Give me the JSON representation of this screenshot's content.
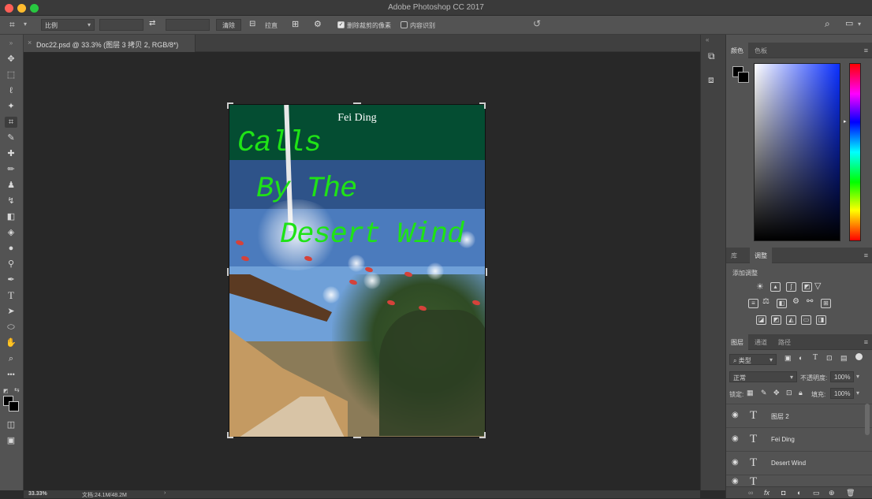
{
  "window": {
    "title": "Adobe Photoshop CC 2017",
    "traffic_lights": {
      "close": "#fe5f57",
      "minimize": "#febc2e",
      "zoom": "#28c840"
    }
  },
  "options_bar": {
    "tool_icon": "crop-icon",
    "ratio_select": "比例",
    "clear_button": "清除",
    "straighten_label": "拉直",
    "delete_cropped_label": "删除裁剪的像素",
    "delete_cropped_checked": true,
    "content_aware_label": "内容识别",
    "content_aware_checked": false
  },
  "document_tab": {
    "label": "Doc22.psd @ 33.3% (图层 3 拷贝 2, RGB/8*)"
  },
  "artwork": {
    "author": "Fei Ding",
    "line1": "Calls",
    "line2": "By The",
    "line3": "Desert Wind",
    "title_color": "#1fe316"
  },
  "color_panel": {
    "tabs": [
      "颜色",
      "色板"
    ],
    "foreground": "#000000",
    "background": "#000000"
  },
  "adjustments_panel": {
    "tabs": [
      "库",
      "调整"
    ],
    "add_label": "添加调整"
  },
  "layers_panel": {
    "tabs": [
      "图层",
      "通道",
      "路径"
    ],
    "filter_label": "类型",
    "blend_mode": "正常",
    "opacity_label": "不透明度:",
    "opacity_value": "100%",
    "lock_label": "锁定:",
    "fill_label": "填充:",
    "fill_value": "100%",
    "layers": [
      {
        "name": "图层 2",
        "visible": true
      },
      {
        "name": "Fei Ding",
        "visible": true
      },
      {
        "name": "Desert Wind",
        "visible": true
      }
    ]
  },
  "status_bar": {
    "zoom": "33.33%",
    "doc_size": "文档:24.1M/48.2M"
  }
}
